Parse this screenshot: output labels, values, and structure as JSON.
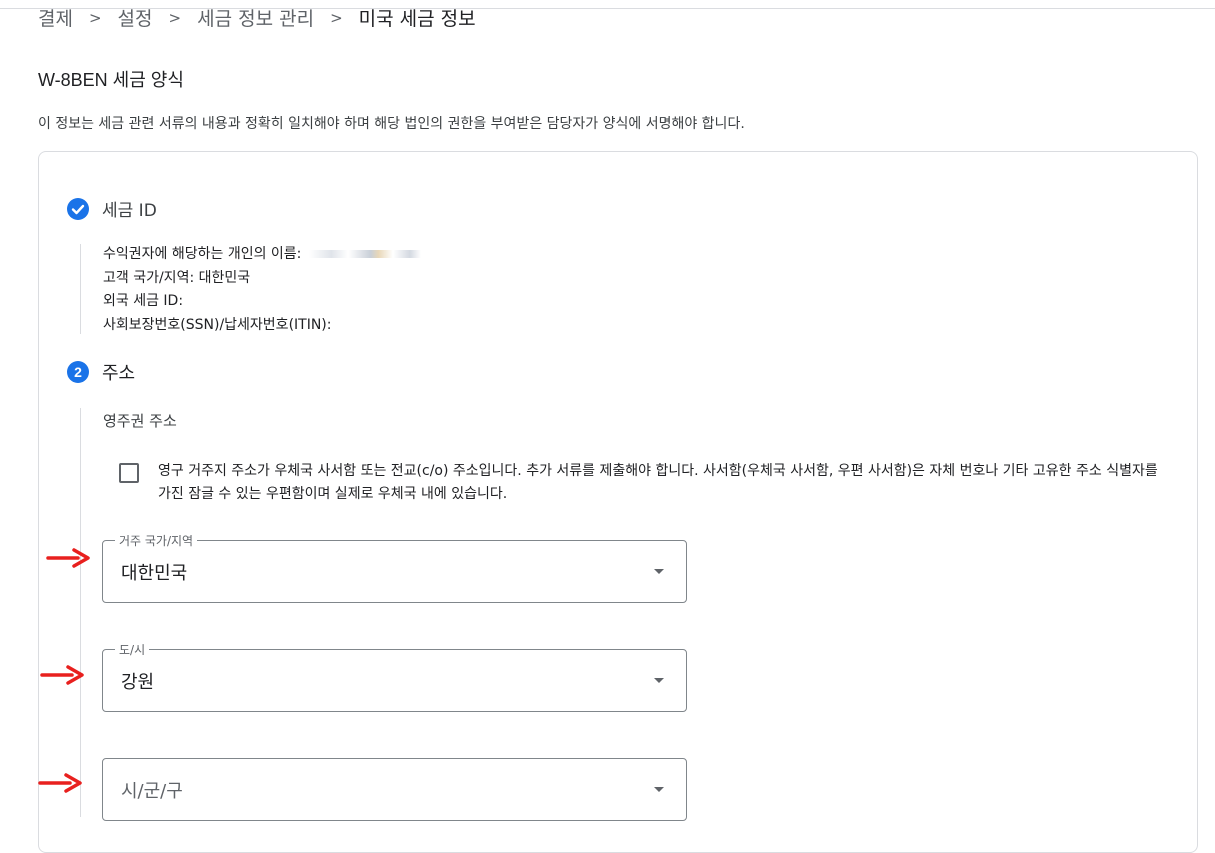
{
  "breadcrumb": [
    "결제",
    "설정",
    "세금 정보 관리",
    "미국 세금 정보"
  ],
  "breadcrumb_separator": ">",
  "form": {
    "title": "W-8BEN 세금 양식",
    "description": "이 정보는 세금 관련 서류의 내용과 정확히 일치해야 하며 해당 법인의 권한을 부여받은 담당자가 양식에 서명해야 합니다."
  },
  "section1": {
    "title": "세금 ID",
    "status_icon": "check-circle-icon",
    "lines": [
      "수익권자에 해당하는 개인의 이름:",
      "고객 국가/지역: 대한민국",
      "외국 세금 ID:",
      "사회보장번호(SSN)/납세자번호(ITIN):"
    ]
  },
  "section2": {
    "step_number": "2",
    "title": "주소",
    "sub_label": "영주권 주소",
    "checkbox": {
      "checked": false,
      "text": "영구 거주지 주소가 우체국 사서함 또는 전교(c/o) 주소입니다. 추가 서류를 제출해야 합니다. 사서함(우체국 사서함, 우편 사서함)은 자체 번호나 기타 고유한 주소 식별자를 가진 잠글 수 있는 우편함이며 실제로 우체국 내에 있습니다."
    },
    "country_select": {
      "label": "거주 국가/지역",
      "value": "대한민국"
    },
    "province_select": {
      "label": "도/시",
      "value": "강원"
    },
    "city_select": {
      "placeholder": "시/군/구"
    }
  },
  "colors": {
    "accent": "#1a73e8",
    "annotation_arrow": "#e8201e",
    "border": "#dadce0"
  }
}
